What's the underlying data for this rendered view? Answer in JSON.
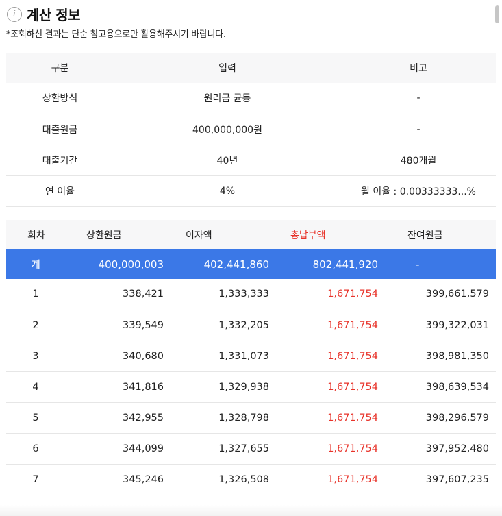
{
  "header": {
    "title": "계산 정보",
    "icon": "info-icon",
    "notice": "*조회하신 결과는 단순 참고용으로만 활용해주시기 바랍니다."
  },
  "summary": {
    "columns": [
      "구분",
      "입력",
      "비고"
    ],
    "rows": [
      [
        "상환방식",
        "원리금 균등",
        "-"
      ],
      [
        "대출원금",
        "400,000,000원",
        "-"
      ],
      [
        "대출기간",
        "40년",
        "480개월"
      ],
      [
        "연 이율",
        "4%",
        "월 이율 : 0.00333333...%"
      ]
    ]
  },
  "schedule": {
    "columns": [
      "회차",
      "상환원금",
      "이자액",
      "총납부액",
      "잔여원금"
    ],
    "total_color": "#e8332a",
    "highlight_color": "#3b78e7",
    "sum_row": [
      "계",
      "400,000,003",
      "402,441,860",
      "802,441,920",
      "-"
    ],
    "rows": [
      [
        "1",
        "338,421",
        "1,333,333",
        "1,671,754",
        "399,661,579"
      ],
      [
        "2",
        "339,549",
        "1,332,205",
        "1,671,754",
        "399,322,031"
      ],
      [
        "3",
        "340,680",
        "1,331,073",
        "1,671,754",
        "398,981,350"
      ],
      [
        "4",
        "341,816",
        "1,329,938",
        "1,671,754",
        "398,639,534"
      ],
      [
        "5",
        "342,955",
        "1,328,798",
        "1,671,754",
        "398,296,579"
      ],
      [
        "6",
        "344,099",
        "1,327,655",
        "1,671,754",
        "397,952,480"
      ],
      [
        "7",
        "345,246",
        "1,326,508",
        "1,671,754",
        "397,607,235"
      ]
    ]
  }
}
